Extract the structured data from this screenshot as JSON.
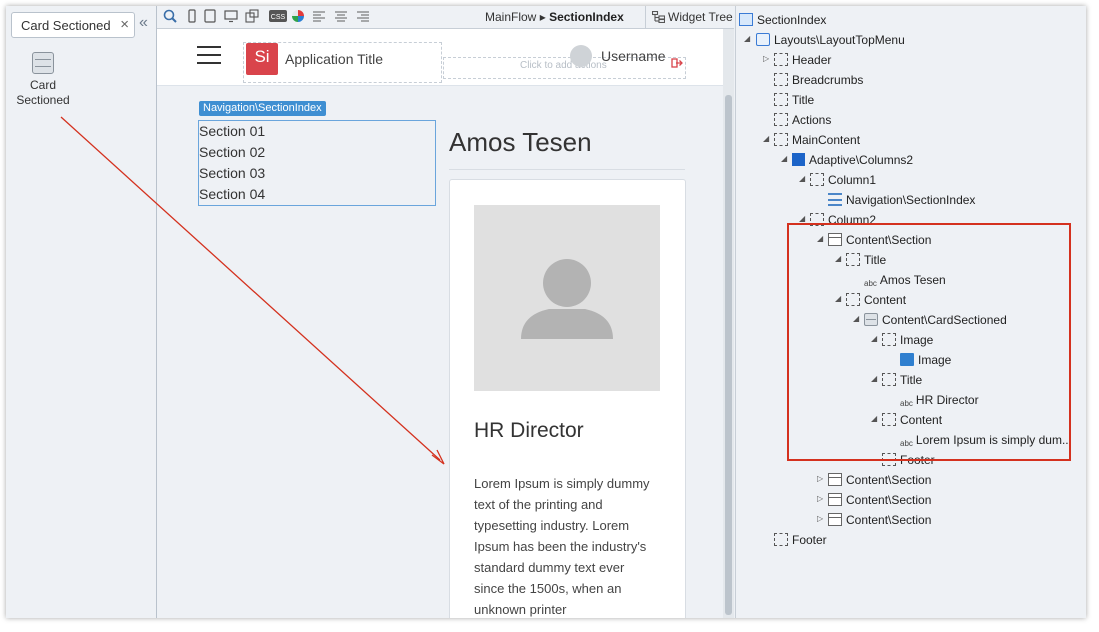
{
  "toolbox": {
    "search_value": "Card Sectioned",
    "clear_label": "×",
    "collapse_label": "«",
    "widget_label": "Card\nSectioned"
  },
  "topbar": {
    "breadcrumb_parent": "MainFlow",
    "breadcrumb_sep": "▸",
    "breadcrumb_current": "SectionIndex",
    "widget_tree_tab": "Widget Tree"
  },
  "canvas": {
    "logo_text": "Si",
    "app_title": "Application Title",
    "actions_hint": "Click to add actions",
    "username": "Username",
    "nav_tag": "Navigation\\SectionIndex",
    "sections": [
      "Section 01",
      "Section 02",
      "Section 03",
      "Section 04"
    ],
    "page_title": "Amos Tesen",
    "card_title": "HR Director",
    "card_text": "Lorem Ipsum is simply dummy text of the printing and typesetting industry. Lorem Ipsum has been the industry's standard dummy text ever since the 1500s, when an unknown printer"
  },
  "tree": {
    "nodes": [
      {
        "label": "SectionIndex",
        "icon": "root"
      },
      {
        "label": "Layouts\\LayoutTopMenu",
        "icon": "layout"
      },
      {
        "label": "Header",
        "icon": "placeholder"
      },
      {
        "label": "Breadcrumbs",
        "icon": "placeholder"
      },
      {
        "label": "Title",
        "icon": "placeholder"
      },
      {
        "label": "Actions",
        "icon": "placeholder"
      },
      {
        "label": "MainContent",
        "icon": "placeholder"
      },
      {
        "label": "Adaptive\\Columns2",
        "icon": "columns"
      },
      {
        "label": "Column1",
        "icon": "placeholder"
      },
      {
        "label": "Navigation\\SectionIndex",
        "icon": "nav"
      },
      {
        "label": "Column2",
        "icon": "placeholder"
      },
      {
        "label": "Content\\Section",
        "icon": "section"
      },
      {
        "label": "Title",
        "icon": "placeholder"
      },
      {
        "label": "Amos Tesen",
        "icon": "text"
      },
      {
        "label": "Content",
        "icon": "placeholder"
      },
      {
        "label": "Content\\CardSectioned",
        "icon": "card"
      },
      {
        "label": "Image",
        "icon": "placeholder"
      },
      {
        "label": "Image",
        "icon": "image"
      },
      {
        "label": "Title",
        "icon": "placeholder"
      },
      {
        "label": "HR Director",
        "icon": "text"
      },
      {
        "label": "Content",
        "icon": "placeholder"
      },
      {
        "label": "Lorem Ipsum is simply dum...",
        "icon": "text"
      },
      {
        "label": "Footer",
        "icon": "placeholder"
      },
      {
        "label": "Content\\Section",
        "icon": "section"
      },
      {
        "label": "Content\\Section",
        "icon": "section"
      },
      {
        "label": "Content\\Section",
        "icon": "section"
      },
      {
        "label": "Footer",
        "icon": "placeholder"
      }
    ],
    "text_icon_label": "abc"
  },
  "colors": {
    "highlight": "#d4311e",
    "logo": "#d9444b",
    "selection": "#3f8fd2"
  }
}
